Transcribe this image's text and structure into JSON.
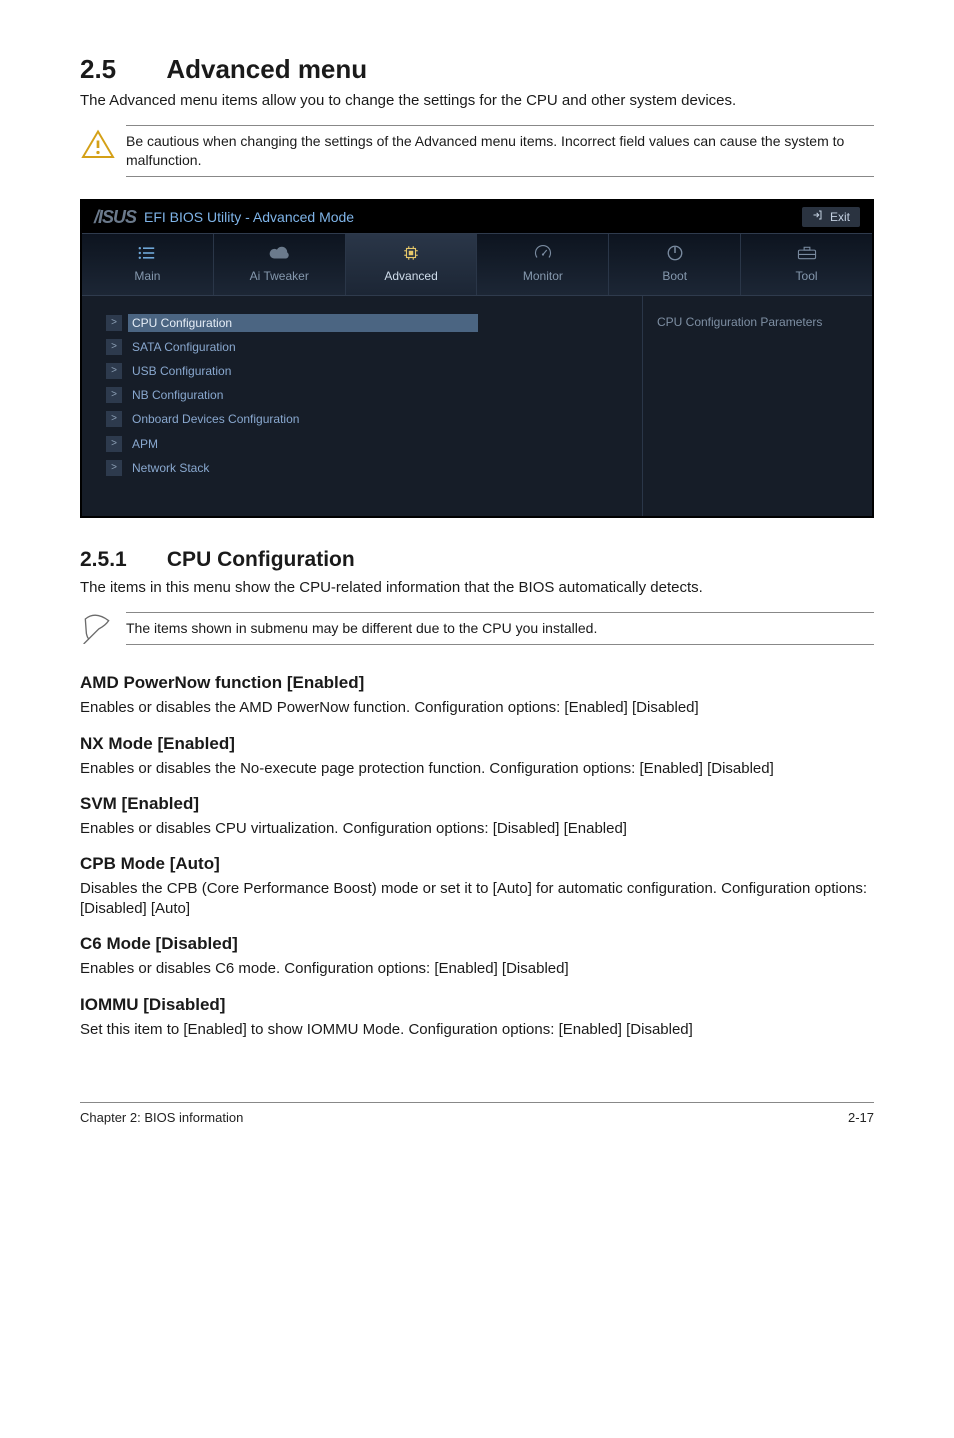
{
  "section": {
    "num": "2.5",
    "title": "Advanced menu"
  },
  "section_intro": "The Advanced menu items allow you to change the settings for the CPU and other system devices.",
  "warning": "Be cautious when changing the settings of the Advanced menu items. Incorrect field values can cause the system to malfunction.",
  "bios": {
    "title": "EFI BIOS Utility - Advanced Mode",
    "exit": "Exit",
    "tabs": {
      "main": "Main",
      "tweaker": "Ai  Tweaker",
      "advanced": "Advanced",
      "monitor": "Monitor",
      "boot": "Boot",
      "tool": "Tool"
    },
    "items": {
      "cpu": "CPU Configuration",
      "sata": "SATA Configuration",
      "usb": "USB Configuration",
      "nb": "NB Configuration",
      "onboard": "Onboard Devices Configuration",
      "apm": "APM",
      "net": "Network Stack"
    },
    "help": "CPU Configuration Parameters"
  },
  "subsection": {
    "num": "2.5.1",
    "title": "CPU Configuration"
  },
  "subsection_intro": "The items in this menu show the CPU-related information that the BIOS automatically detects.",
  "note": "The items shown in submenu may be different due to the CPU you installed.",
  "options": {
    "pn": {
      "h": "AMD PowerNow function [Enabled]",
      "d": "Enables or disables the AMD PowerNow function. Configuration options: [Enabled] [Disabled]"
    },
    "nx": {
      "h": "NX Mode [Enabled]",
      "d": "Enables or disables the No-execute page protection function. Configuration options: [Enabled] [Disabled]"
    },
    "svm": {
      "h": "SVM [Enabled]",
      "d": "Enables or disables CPU virtualization. Configuration options: [Disabled] [Enabled]"
    },
    "cpb": {
      "h": "CPB Mode [Auto]",
      "d": "Disables the CPB (Core Performance Boost) mode or set it to [Auto] for automatic configuration. Configuration options: [Disabled] [Auto]"
    },
    "c6": {
      "h": "C6 Mode [Disabled]",
      "d": "Enables or disables C6 mode. Configuration options: [Enabled] [Disabled]"
    },
    "iom": {
      "h": "IOMMU [Disabled]",
      "d": "Set this item to [Enabled] to show IOMMU Mode. Configuration options: [Enabled] [Disabled]"
    }
  },
  "footer": {
    "chapter": "Chapter 2: BIOS information",
    "page": "2-17"
  }
}
